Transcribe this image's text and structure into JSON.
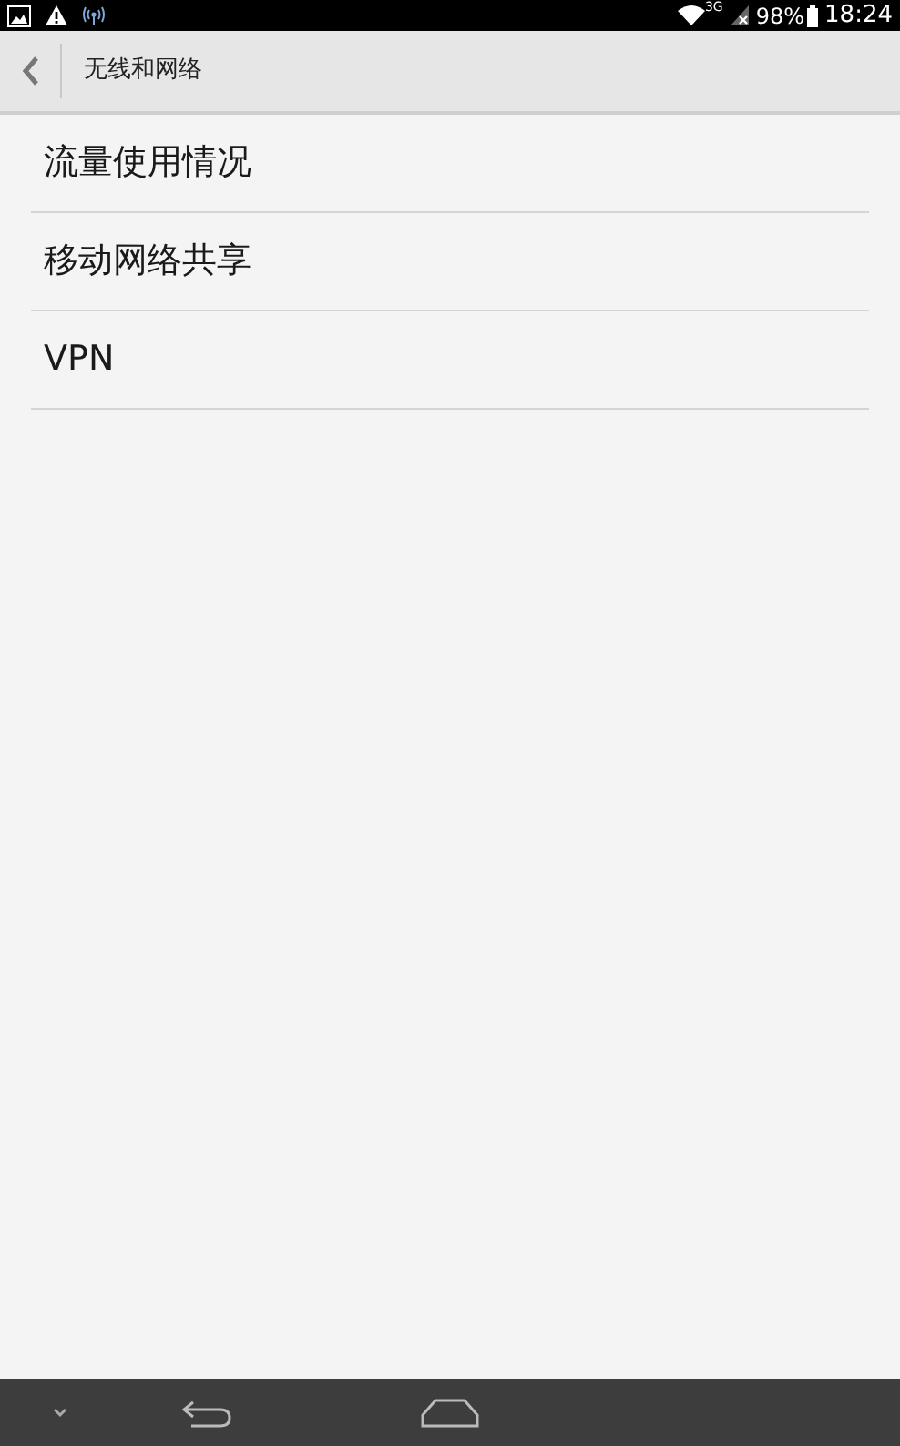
{
  "status_bar": {
    "network": "3G",
    "battery": "98%",
    "time": "18:24"
  },
  "header": {
    "title": "无线和网络"
  },
  "items": [
    {
      "label": "流量使用情况"
    },
    {
      "label": "移动网络共享"
    },
    {
      "label": "VPN"
    }
  ]
}
